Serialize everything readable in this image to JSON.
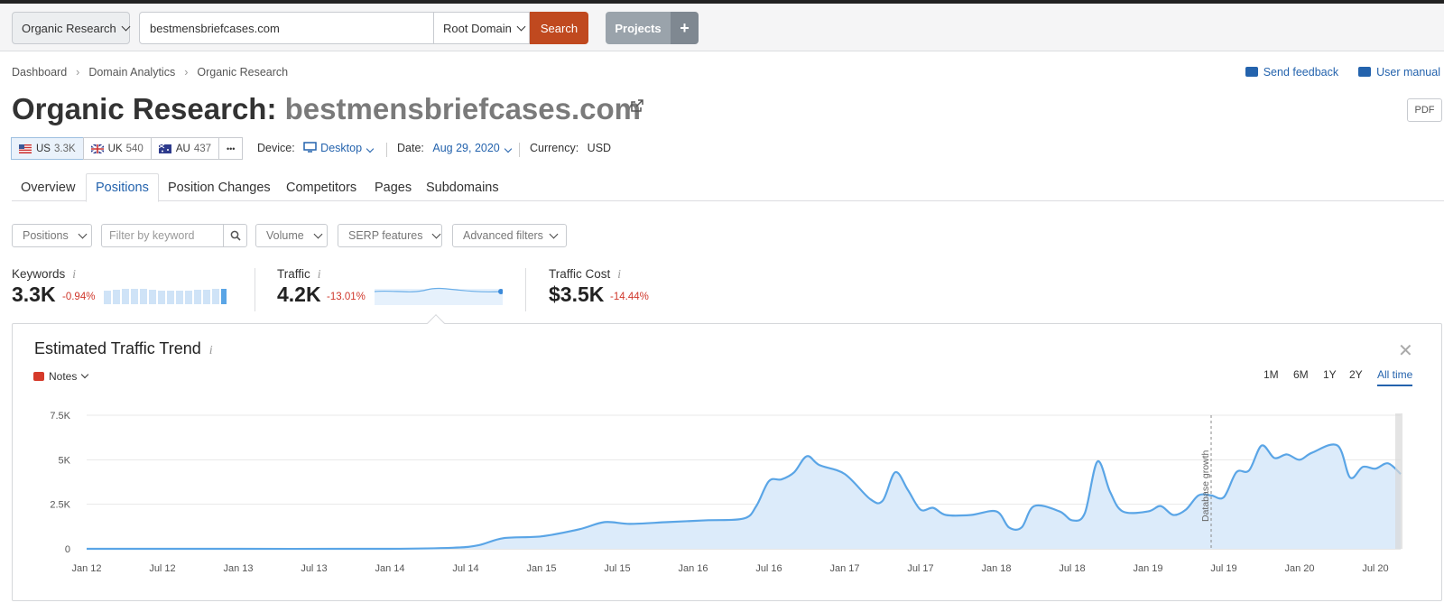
{
  "topbar": {
    "tool_label": "Organic Research",
    "domain_value": "bestmensbriefcases.com",
    "scope_label": "Root Domain",
    "search_label": "Search",
    "projects_label": "Projects",
    "plus_label": "+"
  },
  "breadcrumb": [
    "Dashboard",
    "Domain Analytics",
    "Organic Research"
  ],
  "links": {
    "feedback": "Send feedback",
    "manual": "User manual"
  },
  "header": {
    "title_prefix": "Organic Research:",
    "title_domain": "bestmensbriefcases.com",
    "pdf_label": "PDF"
  },
  "databases": [
    {
      "code": "US",
      "count": "3.3K"
    },
    {
      "code": "UK",
      "count": "540"
    },
    {
      "code": "AU",
      "count": "437"
    }
  ],
  "more_label": "•••",
  "meta": {
    "device_label": "Device:",
    "device_value": "Desktop",
    "date_label": "Date:",
    "date_value": "Aug 29, 2020",
    "currency_label": "Currency:",
    "currency_value": "USD"
  },
  "tabs": [
    "Overview",
    "Positions",
    "Position Changes",
    "Competitors",
    "Pages",
    "Subdomains"
  ],
  "active_tab": "Positions",
  "filters": {
    "positions": "Positions",
    "keyword_placeholder": "Filter by keyword",
    "volume": "Volume",
    "serp": "SERP features",
    "advanced": "Advanced filters"
  },
  "kpis": [
    {
      "label": "Keywords",
      "value": "3.3K",
      "change": "-0.94%"
    },
    {
      "label": "Traffic",
      "value": "4.2K",
      "change": "-13.01%"
    },
    {
      "label": "Traffic Cost",
      "value": "$3.5K",
      "change": "-14.44%"
    }
  ],
  "panel": {
    "title": "Estimated Traffic Trend",
    "notes_label": "Notes",
    "close_label": "✕",
    "ranges": [
      "1M",
      "6M",
      "1Y",
      "2Y",
      "All time"
    ],
    "active_range": "All time",
    "annotation": "Database growth"
  },
  "colors": {
    "accent": "#2463ad",
    "search": "#c0491f",
    "line": "#5aa5e6",
    "area": "#dcebfa",
    "negative": "#d0382c"
  },
  "chart_data": {
    "type": "area",
    "title": "Estimated Traffic Trend",
    "ylim": [
      0,
      7500
    ],
    "yticks": [
      "0",
      "2.5K",
      "5K",
      "7.5K"
    ],
    "ytick_values": [
      0,
      2500,
      5000,
      7500
    ],
    "xticks": [
      "Jan 12",
      "Jul 12",
      "Jan 13",
      "Jul 13",
      "Jan 14",
      "Jul 14",
      "Jan 15",
      "Jul 15",
      "Jan 16",
      "Jul 16",
      "Jan 17",
      "Jul 17",
      "Jan 18",
      "Jul 18",
      "Jan 19",
      "Jul 19",
      "Jan 20",
      "Jul 20"
    ],
    "series": [
      {
        "name": "Traffic",
        "points": [
          [
            "2012-01",
            0
          ],
          [
            "2013-01",
            0
          ],
          [
            "2014-01",
            0
          ],
          [
            "2014-06",
            60
          ],
          [
            "2014-08",
            200
          ],
          [
            "2014-10",
            600
          ],
          [
            "2015-01",
            700
          ],
          [
            "2015-04",
            1100
          ],
          [
            "2015-06",
            1500
          ],
          [
            "2015-08",
            1400
          ],
          [
            "2015-11",
            1500
          ],
          [
            "2016-02",
            1600
          ],
          [
            "2016-05",
            1700
          ],
          [
            "2016-06",
            2400
          ],
          [
            "2016-07",
            3800
          ],
          [
            "2016-08",
            3900
          ],
          [
            "2016-09",
            4300
          ],
          [
            "2016-10",
            5200
          ],
          [
            "2016-11",
            4700
          ],
          [
            "2017-01",
            4200
          ],
          [
            "2017-03",
            2800
          ],
          [
            "2017-04",
            2700
          ],
          [
            "2017-05",
            4300
          ],
          [
            "2017-06",
            3300
          ],
          [
            "2017-07",
            2200
          ],
          [
            "2017-08",
            2300
          ],
          [
            "2017-09",
            1900
          ],
          [
            "2017-11",
            1900
          ],
          [
            "2018-01",
            2100
          ],
          [
            "2018-02",
            1200
          ],
          [
            "2018-03",
            1200
          ],
          [
            "2018-04",
            2400
          ],
          [
            "2018-06",
            2100
          ],
          [
            "2018-07",
            1600
          ],
          [
            "2018-08",
            2000
          ],
          [
            "2018-09",
            4900
          ],
          [
            "2018-10",
            3200
          ],
          [
            "2018-11",
            2100
          ],
          [
            "2019-01",
            2100
          ],
          [
            "2019-02",
            2400
          ],
          [
            "2019-03",
            1900
          ],
          [
            "2019-04",
            2200
          ],
          [
            "2019-05",
            3000
          ],
          [
            "2019-06",
            3000
          ],
          [
            "2019-07",
            2900
          ],
          [
            "2019-08",
            4300
          ],
          [
            "2019-09",
            4400
          ],
          [
            "2019-10",
            5800
          ],
          [
            "2019-11",
            5100
          ],
          [
            "2019-12",
            5300
          ],
          [
            "2020-01",
            5000
          ],
          [
            "2020-02",
            5400
          ],
          [
            "2020-04",
            5800
          ],
          [
            "2020-05",
            4000
          ],
          [
            "2020-06",
            4600
          ],
          [
            "2020-07",
            4500
          ],
          [
            "2020-08",
            4800
          ],
          [
            "2020-09",
            4200
          ]
        ]
      }
    ]
  }
}
